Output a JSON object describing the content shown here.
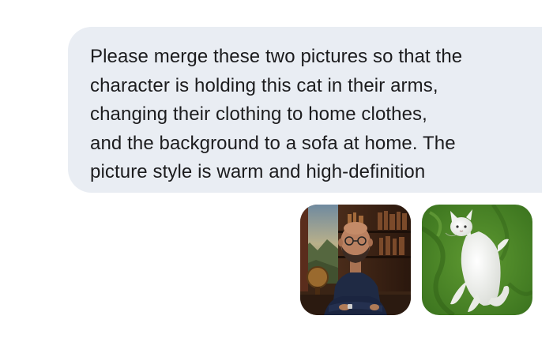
{
  "message": {
    "text": "Please merge these two pictures so that the\ncharacter is holding this cat in their arms,\nchanging their clothing to home clothes,\nand the background to a sofa at home. The\npicture style is warm and high-definition"
  },
  "attachments": [
    {
      "icon": "person-photo"
    },
    {
      "icon": "cat-photo"
    }
  ],
  "colors": {
    "bubble": "#e9edf3",
    "text": "#1c1c1e",
    "background": "#ffffff"
  }
}
